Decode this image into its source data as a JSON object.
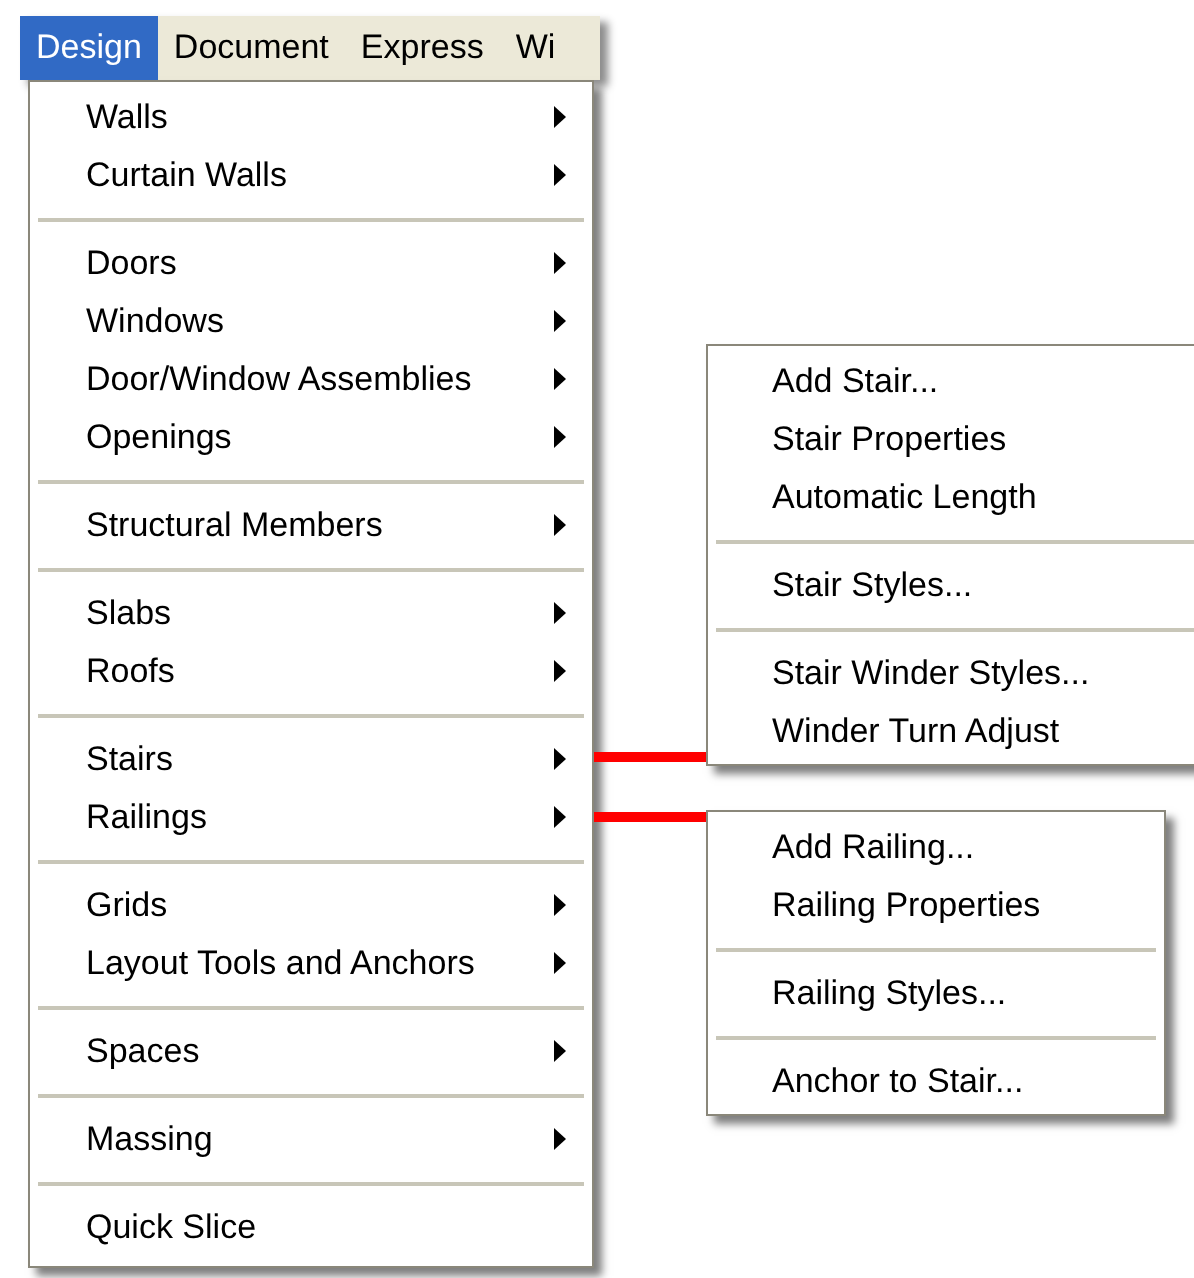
{
  "menubar": [
    {
      "label": "Design",
      "selected": true
    },
    {
      "label": "Document",
      "selected": false
    },
    {
      "label": "Express",
      "selected": false
    },
    {
      "label": "Wi",
      "selected": false
    }
  ],
  "menu": [
    {
      "kind": "item",
      "label": "Walls",
      "has_submenu": true
    },
    {
      "kind": "item",
      "label": "Curtain Walls",
      "has_submenu": true
    },
    {
      "kind": "separator"
    },
    {
      "kind": "item",
      "label": "Doors",
      "has_submenu": true
    },
    {
      "kind": "item",
      "label": "Windows",
      "has_submenu": true
    },
    {
      "kind": "item",
      "label": "Door/Window Assemblies",
      "has_submenu": true
    },
    {
      "kind": "item",
      "label": "Openings",
      "has_submenu": true
    },
    {
      "kind": "separator"
    },
    {
      "kind": "item",
      "label": "Structural Members",
      "has_submenu": true
    },
    {
      "kind": "separator"
    },
    {
      "kind": "item",
      "label": "Slabs",
      "has_submenu": true
    },
    {
      "kind": "item",
      "label": "Roofs",
      "has_submenu": true
    },
    {
      "kind": "separator"
    },
    {
      "kind": "item",
      "label": "Stairs",
      "has_submenu": true,
      "submenu": [
        {
          "kind": "item",
          "label": "Add Stair..."
        },
        {
          "kind": "item",
          "label": "Stair Properties"
        },
        {
          "kind": "item",
          "label": "Automatic Length"
        },
        {
          "kind": "separator"
        },
        {
          "kind": "item",
          "label": "Stair Styles..."
        },
        {
          "kind": "separator"
        },
        {
          "kind": "item",
          "label": "Stair Winder Styles..."
        },
        {
          "kind": "item",
          "label": "Winder Turn Adjust"
        }
      ]
    },
    {
      "kind": "item",
      "label": "Railings",
      "has_submenu": true,
      "submenu": [
        {
          "kind": "item",
          "label": "Add Railing..."
        },
        {
          "kind": "item",
          "label": "Railing Properties"
        },
        {
          "kind": "separator"
        },
        {
          "kind": "item",
          "label": "Railing Styles..."
        },
        {
          "kind": "separator"
        },
        {
          "kind": "item",
          "label": "Anchor to Stair..."
        }
      ]
    },
    {
      "kind": "separator"
    },
    {
      "kind": "item",
      "label": "Grids",
      "has_submenu": true
    },
    {
      "kind": "item",
      "label": "Layout Tools and Anchors",
      "has_submenu": true
    },
    {
      "kind": "separator"
    },
    {
      "kind": "item",
      "label": "Spaces",
      "has_submenu": true
    },
    {
      "kind": "separator"
    },
    {
      "kind": "item",
      "label": "Massing",
      "has_submenu": true
    },
    {
      "kind": "separator"
    },
    {
      "kind": "item",
      "label": "Quick Slice",
      "has_submenu": false
    }
  ]
}
